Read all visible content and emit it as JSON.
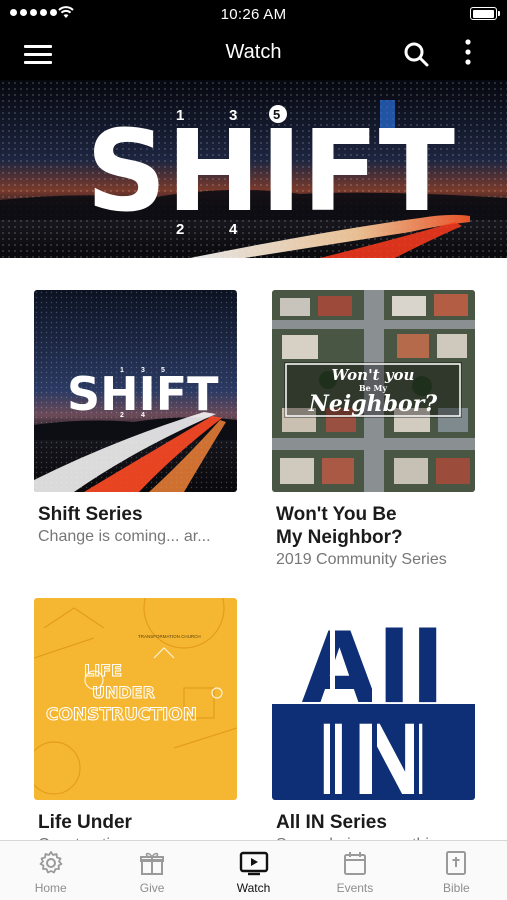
{
  "status": {
    "time": "10:26 AM"
  },
  "header": {
    "title": "Watch"
  },
  "hero": {
    "artwork_title": "SHIFT",
    "numbers": [
      "1",
      "2",
      "3",
      "4",
      "5"
    ]
  },
  "series": [
    {
      "title": "Shift Series",
      "subtitle": "Change is coming... ar...",
      "artwork": {
        "title": "SHIFT",
        "numbers": [
          "1",
          "2",
          "3",
          "4",
          "5"
        ]
      }
    },
    {
      "title": "Won't You Be\nMy Neighbor?",
      "subtitle": "2019 Community Series",
      "artwork": {
        "line1": "Won't you",
        "line2": "Be My",
        "line3": "Neighbor?"
      }
    },
    {
      "title": "Life Under",
      "subtitle": "Construction",
      "artwork": {
        "church": "TRANSFORMATION CHURCH",
        "line1": "LIFE",
        "line2": "UNDER",
        "line3": "CONSTRUCTION"
      }
    },
    {
      "title": "All IN Series",
      "subtitle": "Surrendering everything",
      "artwork": {
        "line1": "All",
        "line2": "IN"
      }
    }
  ],
  "tabs": [
    {
      "label": "Home",
      "icon": "gear-icon"
    },
    {
      "label": "Give",
      "icon": "gift-icon"
    },
    {
      "label": "Watch",
      "icon": "video-icon",
      "active": true
    },
    {
      "label": "Events",
      "icon": "calendar-icon"
    },
    {
      "label": "Bible",
      "icon": "bible-icon"
    }
  ],
  "colors": {
    "header_bg": "#000000",
    "active_tab": "#111111",
    "inactive_tab": "#8e8e8e",
    "construction_yellow": "#f5b731",
    "all_in_blue": "#0e2f75"
  }
}
